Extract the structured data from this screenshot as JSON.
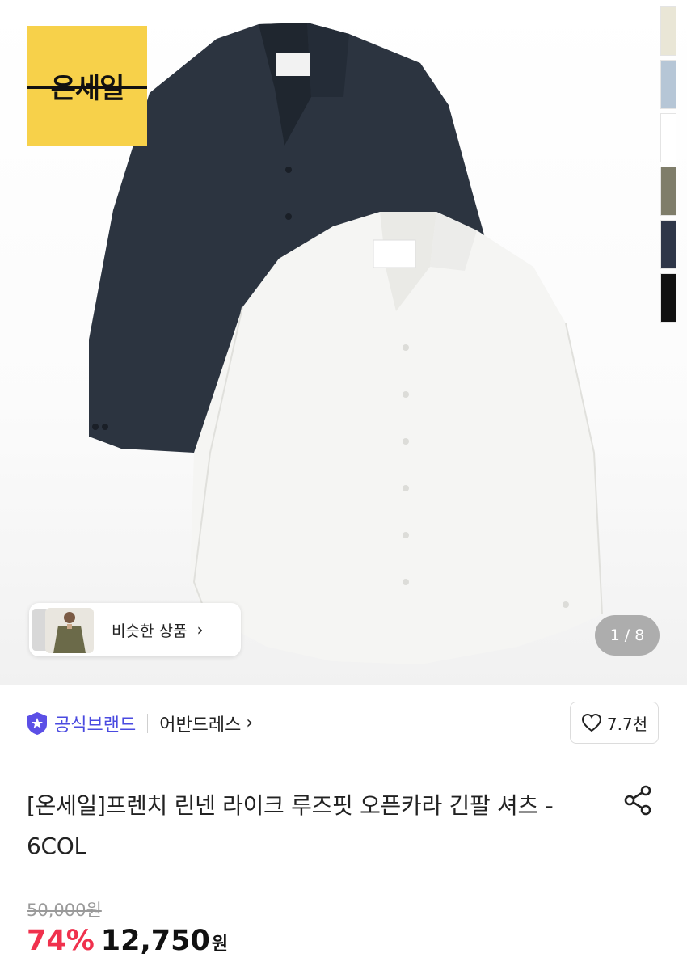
{
  "hero": {
    "sale_badge": "온세일",
    "similar_products_label": "비슷한 상품",
    "similar_arrow": "›",
    "page_current": "1",
    "page_separator": "/",
    "page_total": "8",
    "swatch_colors": [
      "#e9e6d6",
      "#b6c6d6",
      "#ffffff",
      "#7f7d6a",
      "#2e3648",
      "#111111"
    ],
    "shirt_colors": {
      "navy": "#2c3440",
      "white": "#f5f5f3"
    }
  },
  "brand": {
    "official_label": "공식브랜드",
    "name": "어반드레스",
    "arrow": "›",
    "like_count": "7.7천",
    "accent_color": "#4a4ae0"
  },
  "product": {
    "title": "[온세일]프렌치 린넨 라이크 루즈핏 오픈카라 긴팔 셔츠 - 6COL",
    "original_price": "50,000원",
    "discount": "74%",
    "price": "12,750",
    "currency": "원",
    "discount_color": "#f0314d"
  }
}
